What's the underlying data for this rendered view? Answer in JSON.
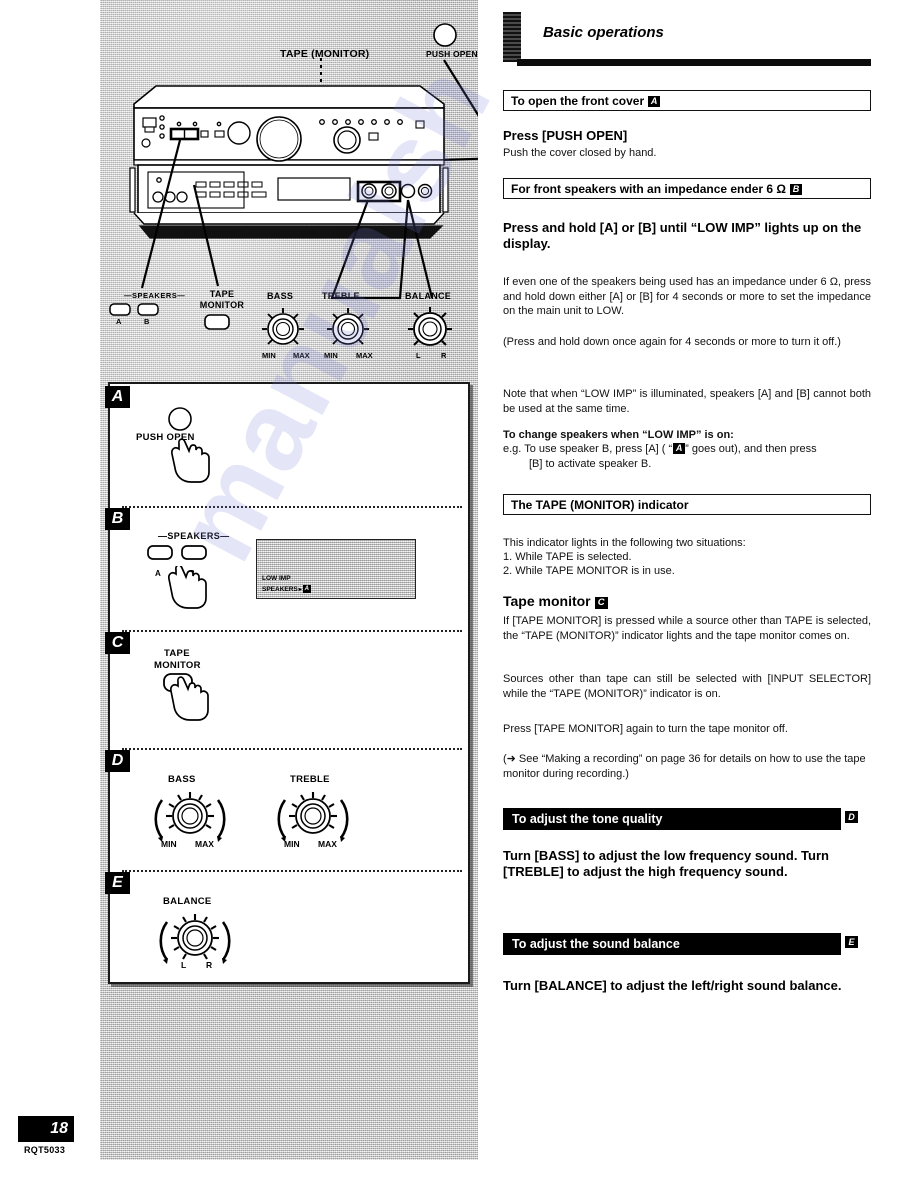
{
  "footer": {
    "page_number": "18",
    "doc_code": "RQT5033"
  },
  "watermark": "manualsh",
  "diagram": {
    "top": {
      "tape_monitor_label": "TAPE (MONITOR)",
      "push_open_label": "PUSH OPEN",
      "speakers_label": "SPEAKERS",
      "speaker_a": "A",
      "speaker_b": "B",
      "tape_monitor_btn_l1": "TAPE",
      "tape_monitor_btn_l2": "MONITOR",
      "bass_label": "BASS",
      "treble_label": "TREBLE",
      "balance_label": "BALANCE",
      "min_label": "MIN",
      "max_label": "MAX",
      "left_label": "L",
      "right_label": "R"
    },
    "panels": [
      {
        "letter": "A",
        "push_open_label": "PUSH OPEN"
      },
      {
        "letter": "B",
        "speakers_label": "SPEAKERS",
        "btn_a": "A",
        "btn_b": "B",
        "display_line1": "LOW IMP",
        "display_line2": "SPEAKERS",
        "display_badge": "A"
      },
      {
        "letter": "C",
        "tape_label_l1": "TAPE",
        "tape_label_l2": "MONITOR"
      },
      {
        "letter": "D",
        "bass_label": "BASS",
        "treble_label": "TREBLE",
        "min_label": "MIN",
        "max_label": "MAX"
      },
      {
        "letter": "E",
        "balance_label": "BALANCE",
        "left_label": "L",
        "right_label": "R"
      }
    ]
  },
  "chapter": {
    "title": "Basic operations"
  },
  "sections": {
    "open_cover": {
      "header": "To open the front cover",
      "header_badge": "A",
      "lead": "Press [PUSH OPEN]",
      "body": "Push the cover closed by hand."
    },
    "impedance": {
      "header": "For front speakers with an impedance ender 6 Ω",
      "header_badge": "B",
      "lead": "Press and hold [A] or [B] until “LOW IMP” lights up on the display.",
      "p1": "If even one of the speakers being used has an impedance under 6 Ω, press and hold down either [A] or [B] for 4 seconds or more to set the impedance on the main unit to LOW.",
      "p2": "(Press and hold down once again for 4 seconds or more to turn it off.)",
      "p3": "Note that when “LOW IMP” is illuminated, speakers [A] and [B] cannot both be used at the same time.",
      "change_title": "To change speakers when “LOW IMP” is on:",
      "change_line1_a": "e.g. To use speaker B, press [A] ( “",
      "change_badge": "A",
      "change_line1_b": "” goes out), and then press",
      "change_line2": "[B] to activate speaker B."
    },
    "tape_indicator": {
      "header": "The TAPE (MONITOR) indicator",
      "p1": "This indicator lights in the following two situations:",
      "item1": "1. While TAPE is selected.",
      "item2": "2. While TAPE MONITOR is in use."
    },
    "tape_monitor": {
      "title": "Tape monitor",
      "title_badge": "C",
      "p1": "If [TAPE MONITOR] is pressed while a source other than TAPE is selected, the “TAPE (MONITOR)” indicator lights and the tape monitor comes on.",
      "p2": "Sources other than tape can still be selected with [INPUT SELECTOR] while the “TAPE (MONITOR)” indicator is on.",
      "p3": "Press [TAPE MONITOR] again to turn the tape monitor off.",
      "p4": "(➜ See “Making a recording” on page 36 for details on how to use the tape monitor during recording.)"
    },
    "tone_quality": {
      "header": "To adjust the tone quality",
      "header_badge": "D",
      "lead": "Turn [BASS] to adjust the low frequency sound. Turn [TREBLE] to adjust the high frequency sound."
    },
    "sound_balance": {
      "header": "To adjust the sound balance",
      "header_badge": "E",
      "lead": "Turn [BALANCE] to adjust the left/right sound balance."
    }
  }
}
